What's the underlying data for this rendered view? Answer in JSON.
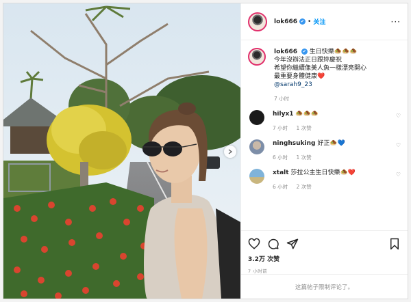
{
  "header": {
    "username": "lok666",
    "verified_mark": "✔",
    "separator": "•",
    "follow_label": "关注",
    "more_label": "···"
  },
  "caption": {
    "username": "lok666",
    "text_line1": "生日快樂🧆🧆🧆",
    "text_line2": "今年沒辦法正日跟妳慶祝",
    "text_line3": "希望你繼續像美人魚一樣漂亮開心",
    "text_line4": "最重要身體健康❤️",
    "mention": "@sarah9_23",
    "time": "7 小时"
  },
  "comments": [
    {
      "username": "hilyx1",
      "text": "🧆🧆🧆",
      "time": "7 小时",
      "likes": "1 次赞",
      "avatar_color": "#1a1a1a"
    },
    {
      "username": "ninghsuking",
      "text": "好正🧆💙",
      "time": "6 小时",
      "likes": "1 次赞",
      "avatar_color": "#9aa6b8"
    },
    {
      "username": "xtalt",
      "text": "莎拉公主生日快樂🧆❤️",
      "time": "6 小时",
      "likes": "2 次赞",
      "avatar_color": "#5e8fb8"
    }
  ],
  "actions": {
    "likes_count": "3.2万 次赞",
    "post_time": "7 小时前"
  },
  "footer": {
    "comments_limited": "这篇帖子限制评论了。"
  },
  "icons": [
    "heart-icon",
    "comment-icon",
    "share-icon",
    "save-icon",
    "next-arrow-icon",
    "verified-icon",
    "small-heart-icon",
    "more-options-icon"
  ],
  "colors": {
    "follow_blue": "#0095f6",
    "verified_blue": "#3897f0",
    "mention": "#00376b",
    "muted": "#8e8e8e",
    "story_ring": "#e1306c"
  }
}
